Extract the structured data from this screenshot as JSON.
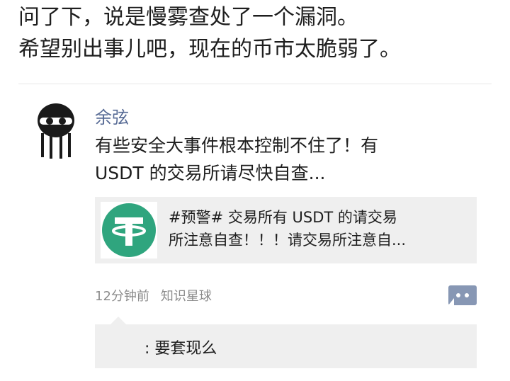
{
  "post": {
    "text_lines": [
      "问了下，说是慢雾查处了一个漏洞。",
      "希望别出事儿吧，现在的币市太脆弱了。"
    ]
  },
  "repost": {
    "author": "余弦",
    "text_lines": [
      "有些安全大事件根本控制不住了！有",
      "USDT 的交易所请尽快自查..."
    ],
    "link_card": {
      "icon": "tether-logo-icon",
      "title_lines": [
        "#预警# 交易所有 USDT 的请交易",
        "所注意自查！！！请交易所注意自..."
      ]
    },
    "time": "12分钟前",
    "source": "知识星球",
    "comment": ": 要套现么"
  },
  "colors": {
    "author_link": "#576b95",
    "tether_green": "#2fa57e",
    "card_bg": "#efefef",
    "meta_gray": "#8c8c8c",
    "comment_btn": "#8797b4"
  }
}
